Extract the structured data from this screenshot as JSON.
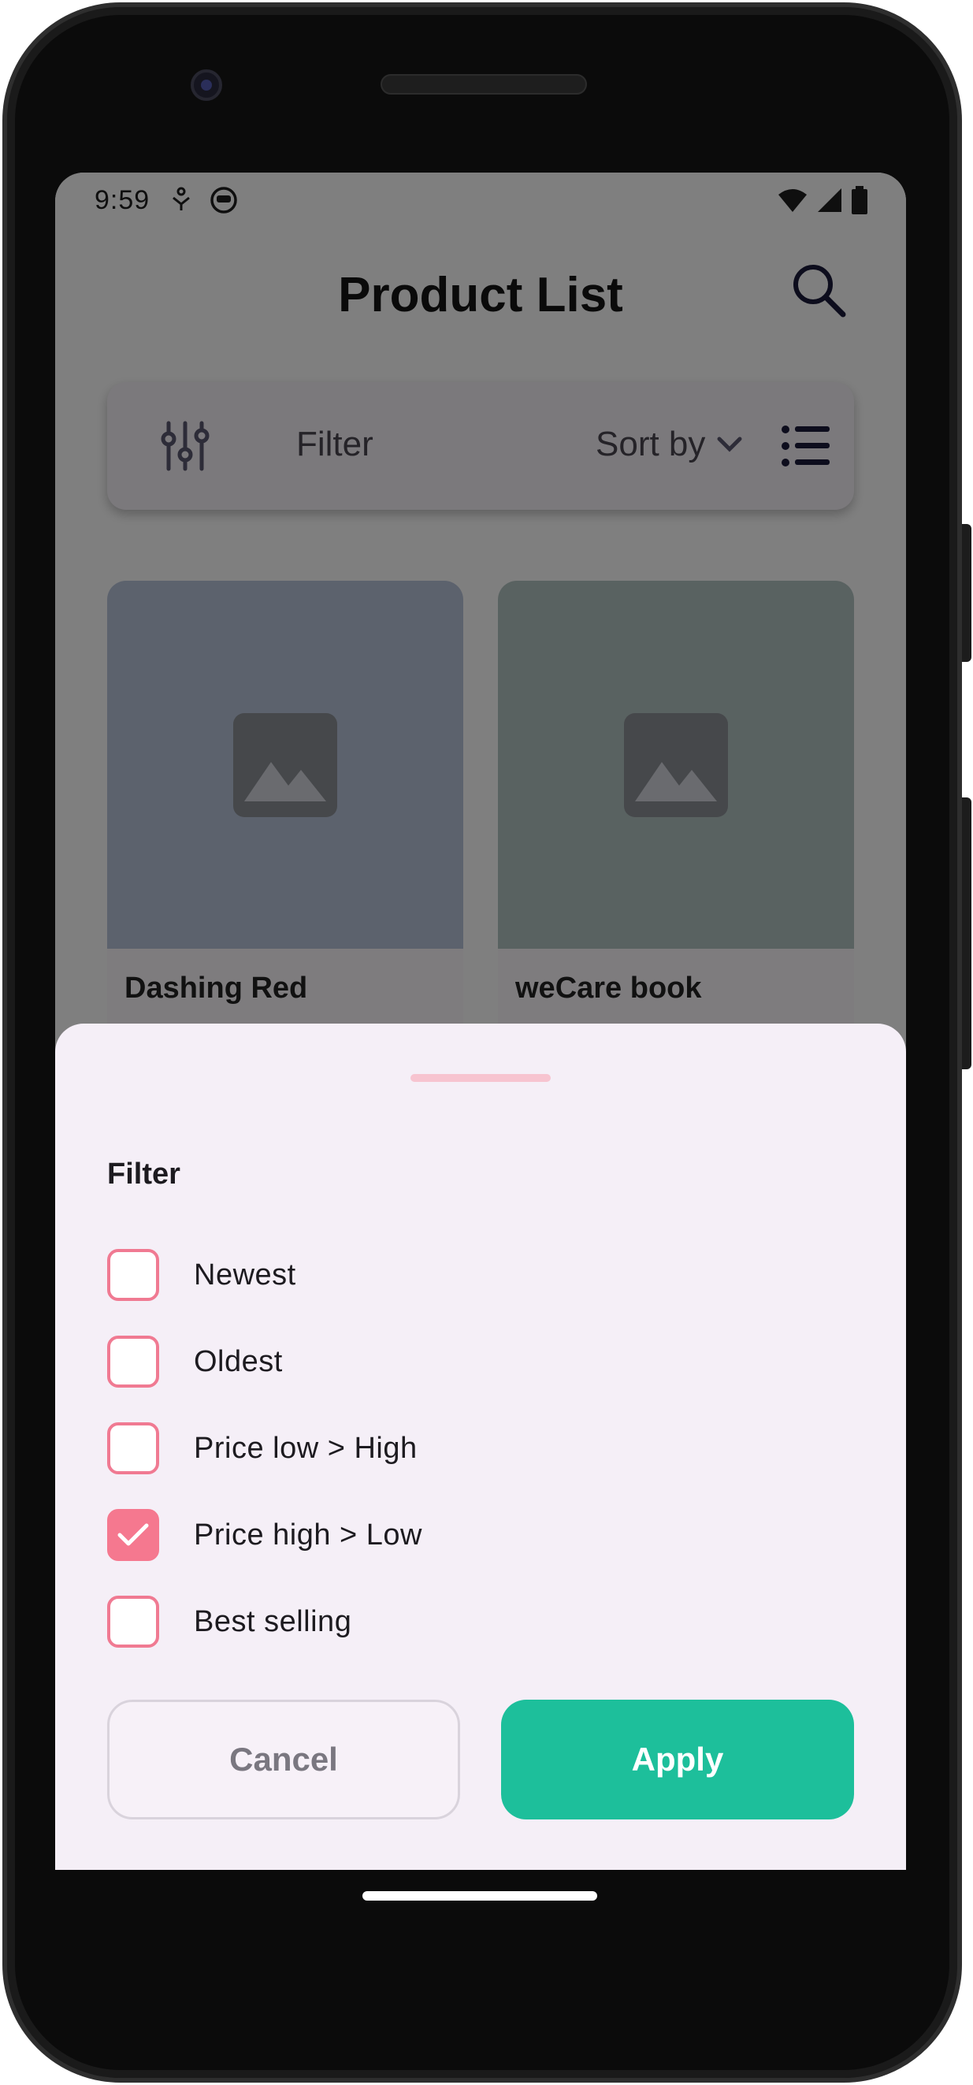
{
  "status_bar": {
    "time": "9:59"
  },
  "app_bar": {
    "title": "Product List"
  },
  "filter_bar": {
    "filter_label": "Filter",
    "sort_label": "Sort by"
  },
  "products": [
    {
      "name": "Dashing Red"
    },
    {
      "name": "weCare book"
    }
  ],
  "filter_sheet": {
    "title": "Filter",
    "options": [
      {
        "label": "Newest",
        "checked": false
      },
      {
        "label": "Oldest",
        "checked": false
      },
      {
        "label": "Price low > High",
        "checked": false
      },
      {
        "label": "Price high > Low",
        "checked": true
      },
      {
        "label": "Best selling",
        "checked": false
      }
    ],
    "cancel_label": "Cancel",
    "apply_label": "Apply"
  },
  "colors": {
    "accent_pink": "#f5788f",
    "apply_green": "#1dbf9b",
    "sheet_background": "#f5eff7"
  }
}
